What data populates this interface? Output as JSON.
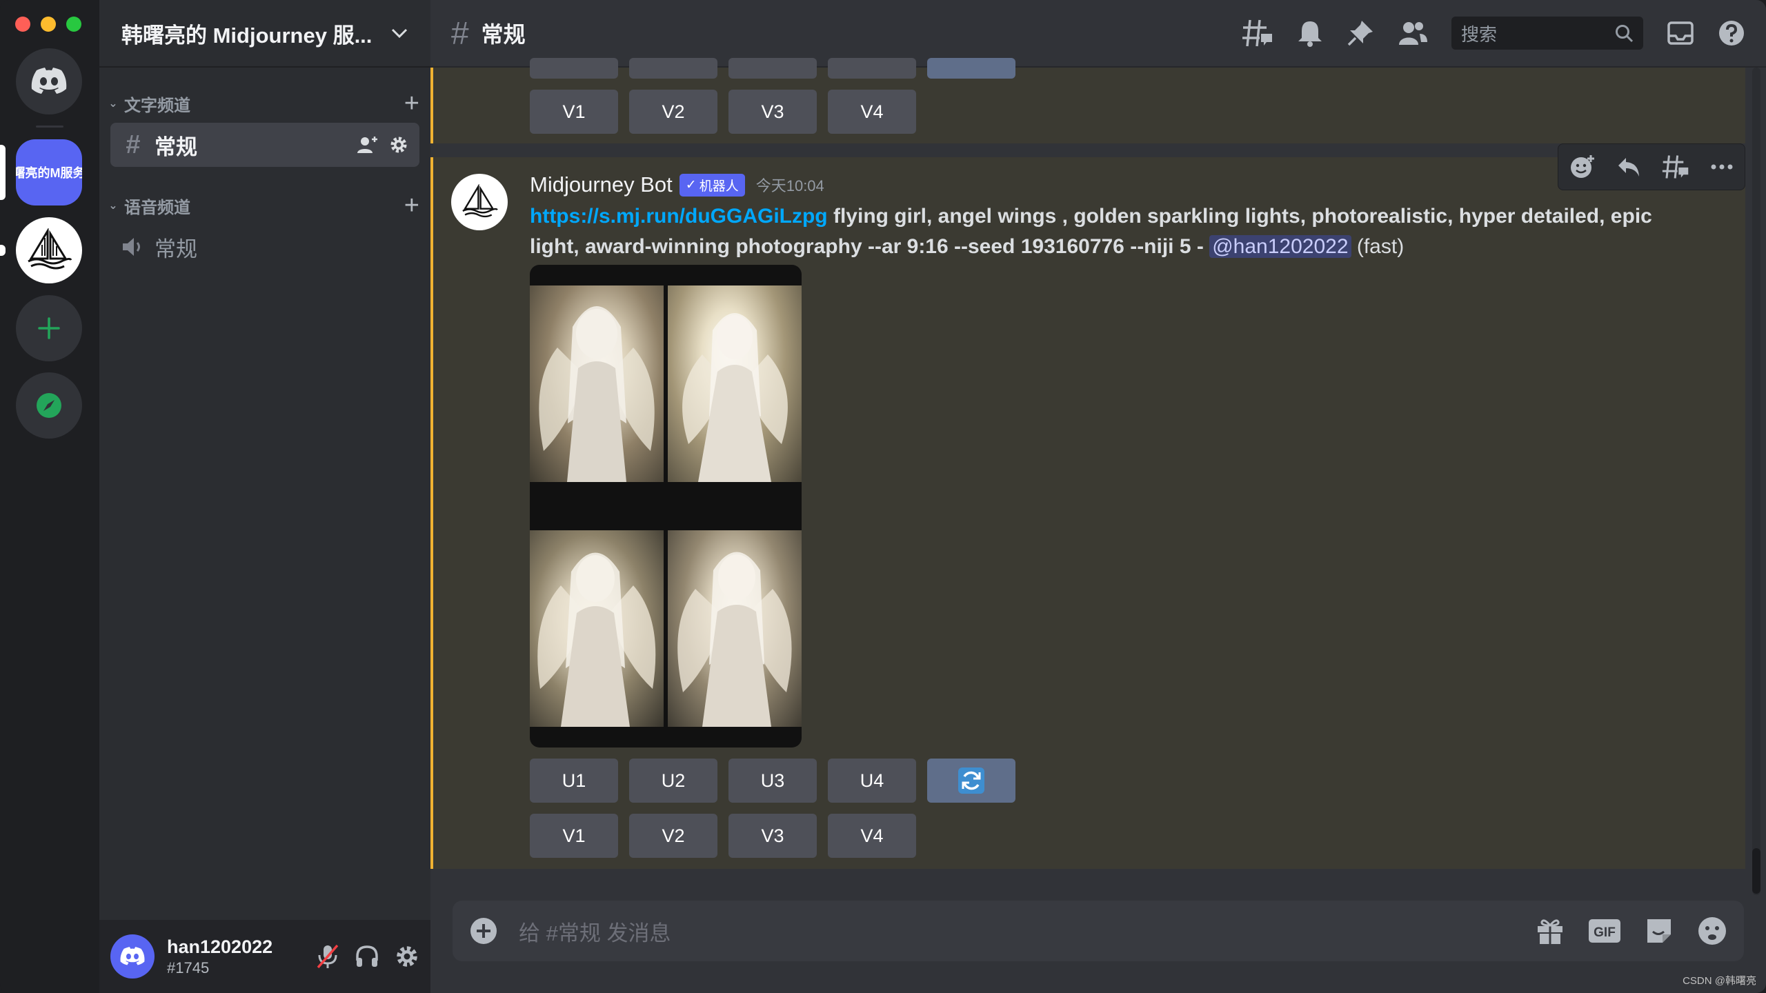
{
  "server": {
    "name": "韩曙亮的 Midjourney 服...",
    "active_server_abbrev": "曙亮的M服务"
  },
  "sidebar": {
    "categories": [
      {
        "label": "文字频道"
      },
      {
        "label": "语音频道"
      }
    ],
    "text_channel": "常规",
    "voice_channel": "常规"
  },
  "user": {
    "name": "han1202022",
    "tag": "#1745"
  },
  "topbar": {
    "channel_name": "常规",
    "search_placeholder": "搜索"
  },
  "top_buttons": {
    "v": [
      "V1",
      "V2",
      "V3",
      "V4"
    ]
  },
  "message": {
    "author": "Midjourney Bot",
    "badge": "机器人",
    "time": "今天10:04",
    "link": "https://s.mj.run/duGGAGiLzpg",
    "prompt": " flying girl, angel wings , golden sparkling lights, photorealistic, hyper detailed, epic light, award-winning photography --ar 9:16 --seed 193160776 --niji 5 - ",
    "mention": "@han1202022",
    "speed": " (fast)"
  },
  "buttons": {
    "u": [
      "U1",
      "U2",
      "U3",
      "U4"
    ],
    "v": [
      "V1",
      "V2",
      "V3",
      "V4"
    ]
  },
  "composer": {
    "placeholder": "给 #常规 发消息"
  },
  "watermark": "CSDN @韩曙亮",
  "colors": {
    "blurple": "#5865f2",
    "accent_highlight": "#f0b232",
    "link": "#00a8fc",
    "green": "#23a55a"
  }
}
